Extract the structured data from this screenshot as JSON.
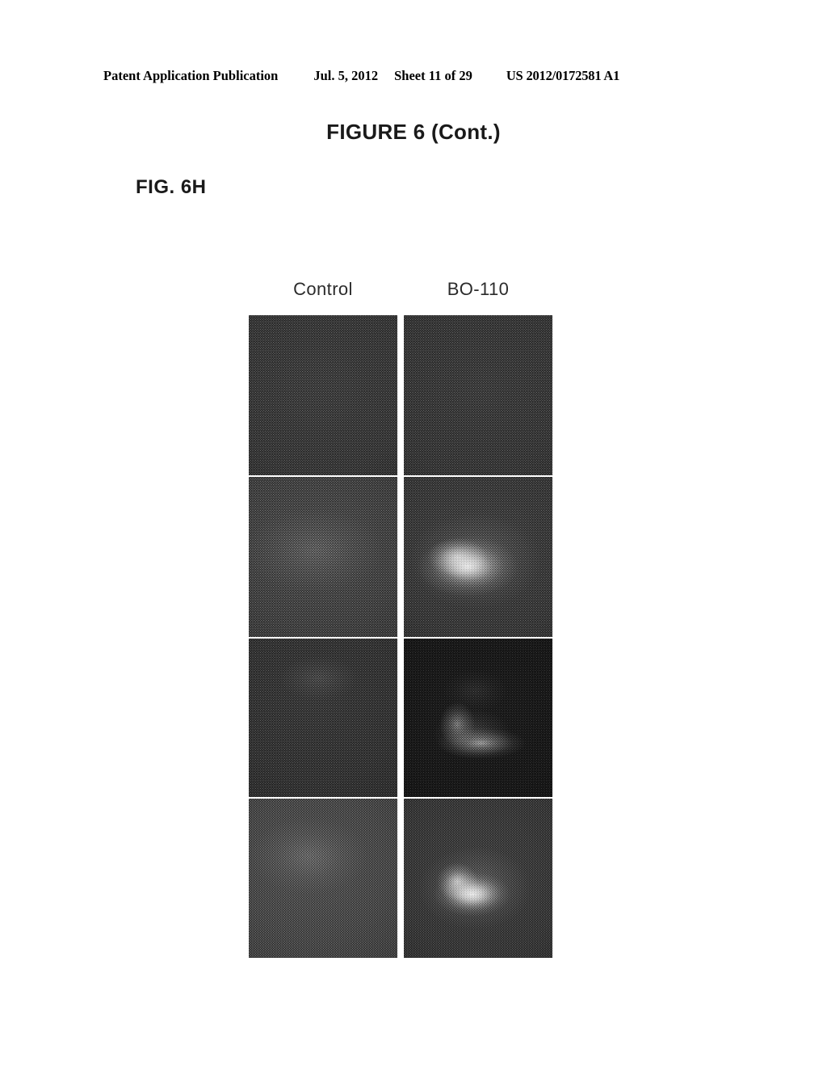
{
  "header": {
    "publication": "Patent Application Publication",
    "date": "Jul. 5, 2012",
    "sheet": "Sheet 11 of 29",
    "patent_number": "US 2012/0172581 A1"
  },
  "figure": {
    "title": "FIGURE 6 (Cont.)",
    "subfigure_label": "FIG. 6H"
  },
  "panel_grid": {
    "columns": [
      {
        "label": "Control"
      },
      {
        "label": "BO-110"
      }
    ],
    "rows": [
      {
        "panels": [
          {
            "column": "Control",
            "tone": "#3c3c3c",
            "description": "uniform dark gray field, no luminescence"
          },
          {
            "column": "BO-110",
            "tone": "#3a3a3a",
            "description": "uniform dark gray field, no luminescence"
          }
        ]
      },
      {
        "panels": [
          {
            "column": "Control",
            "tone": "#4a4a4a",
            "description": "medium gray field, faint diffuse brightening"
          },
          {
            "column": "BO-110",
            "tone": "#3b3b3b",
            "description": "bright elongated luminescent signal left of center"
          }
        ]
      },
      {
        "panels": [
          {
            "column": "Control",
            "tone": "#343434",
            "description": "dark gray field with very faint upper highlight"
          },
          {
            "column": "BO-110",
            "tone": "#0c0c0c",
            "description": "near black field with crescent shaped luminescent arc"
          }
        ]
      },
      {
        "panels": [
          {
            "column": "Control",
            "tone": "#535353",
            "description": "lighter gray field, broad soft gradient"
          },
          {
            "column": "BO-110",
            "tone": "#3a3a3a",
            "description": "bright oval luminescent signal lower center"
          }
        ]
      }
    ]
  },
  "colors": {
    "page_background": "#ffffff",
    "text": "#000000",
    "title_text": "#1a1a1a",
    "label_text": "#2b2b2b"
  }
}
